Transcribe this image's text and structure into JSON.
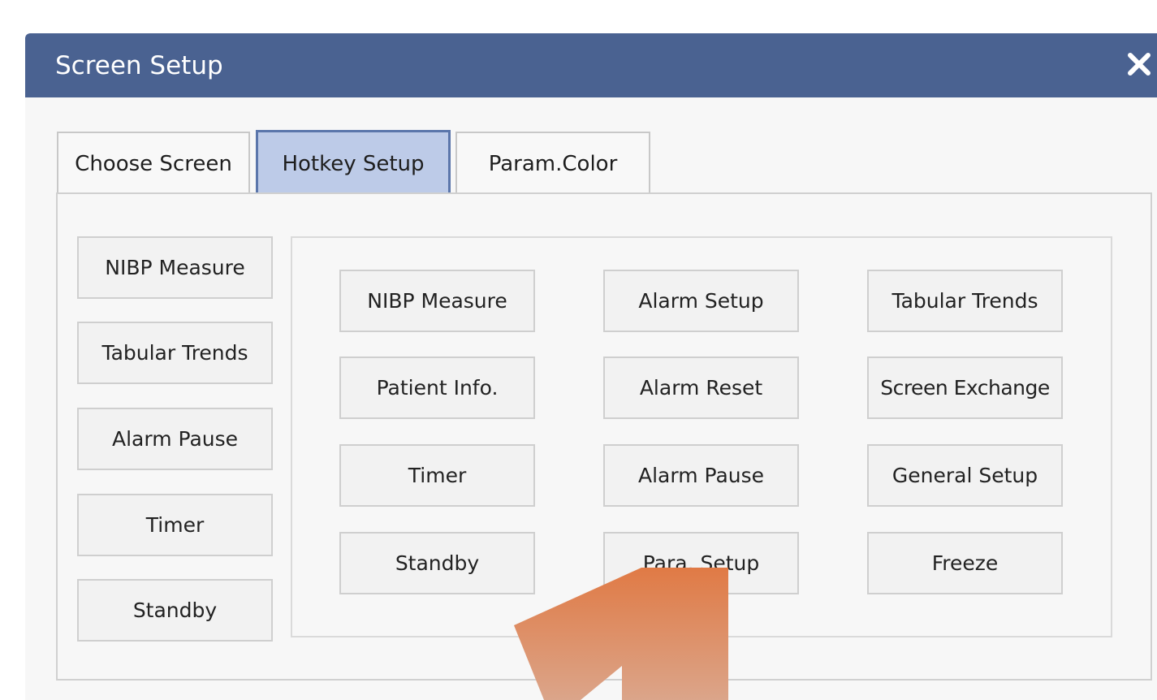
{
  "dialog": {
    "title": "Screen Setup",
    "close_icon": "close-icon"
  },
  "tabs": [
    {
      "label": "Choose Screen",
      "active": false
    },
    {
      "label": "Hotkey Setup",
      "active": true
    },
    {
      "label": "Param.Color",
      "active": false
    }
  ],
  "selected_hotkeys": [
    "NIBP Measure",
    "Tabular Trends",
    "Alarm Pause",
    "Timer",
    "Standby"
  ],
  "available_hotkeys": [
    [
      "NIBP Measure",
      "Alarm Setup",
      "Tabular Trends"
    ],
    [
      "Patient Info.",
      "Alarm Reset",
      "Screen Exchange"
    ],
    [
      "Timer",
      "Alarm Pause",
      "General Setup"
    ],
    [
      "Standby",
      "Para. Setup",
      "Freeze"
    ]
  ],
  "colors": {
    "titlebar": "#4a6291",
    "active_tab": "#bdcbe8",
    "active_tab_border": "#5b76ab",
    "overlay_arrow": "#e07a45"
  }
}
